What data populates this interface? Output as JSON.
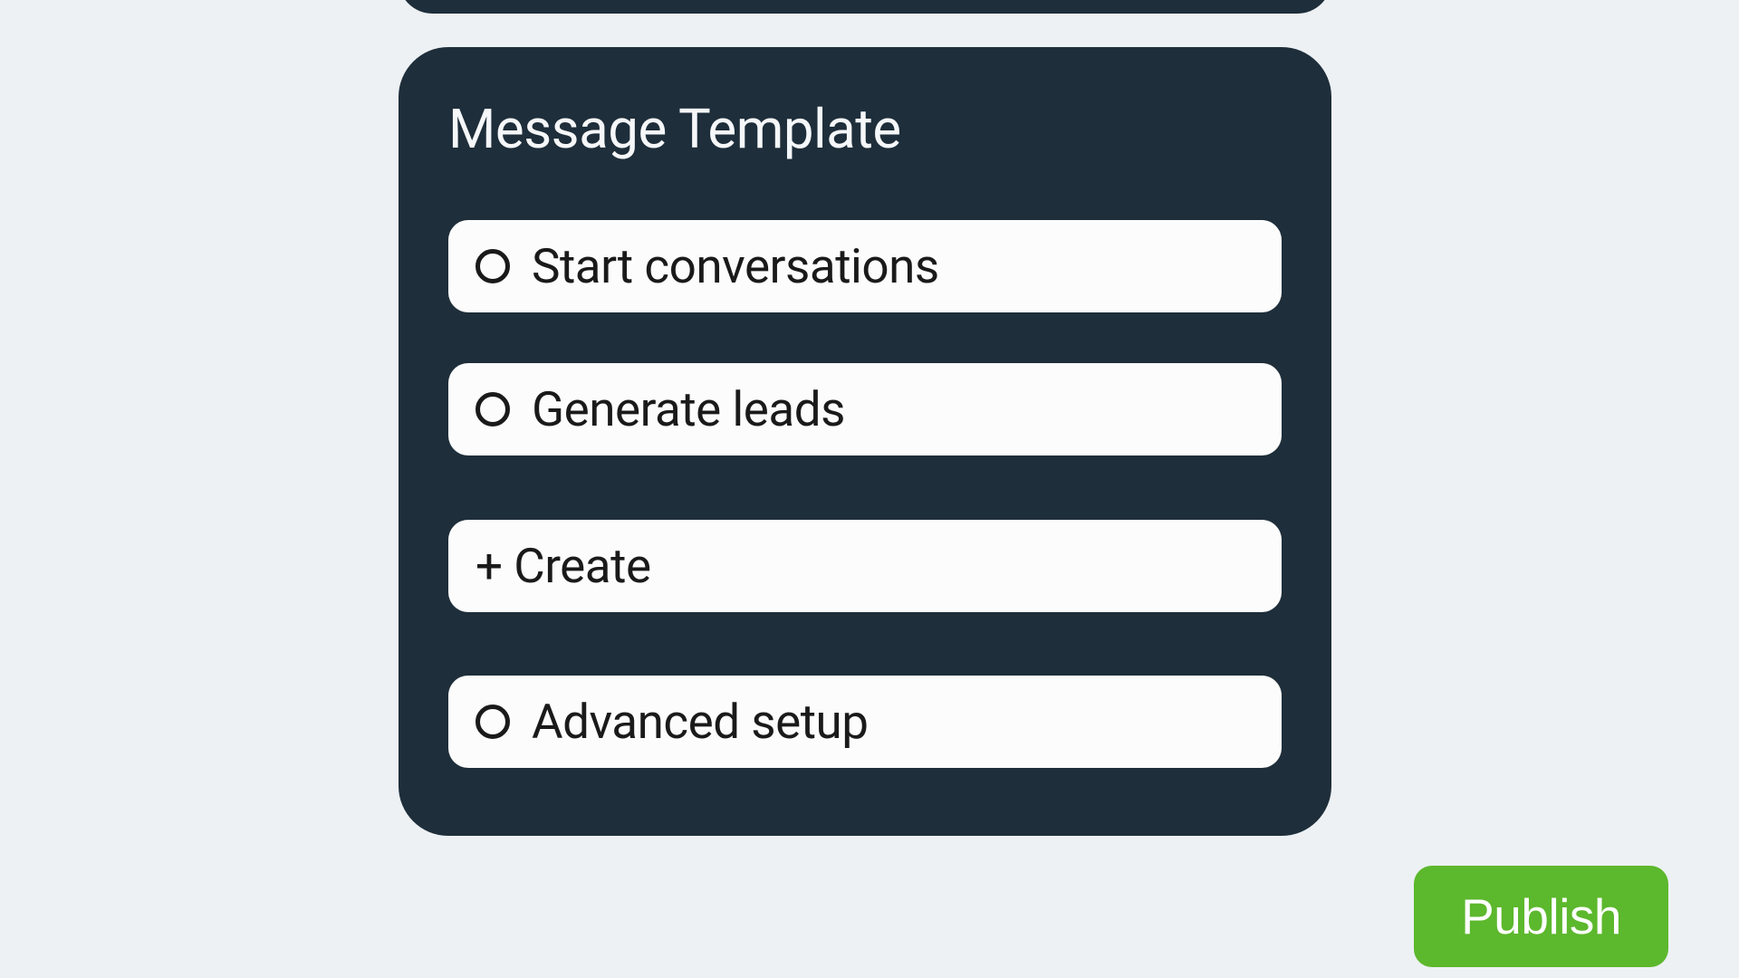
{
  "card": {
    "title": "Message Template",
    "options": [
      {
        "label": "Start conversations"
      },
      {
        "label": "Generate leads"
      },
      {
        "label": "Advanced setup"
      }
    ],
    "create_button": "+ Create"
  },
  "publish_button": "Publish"
}
